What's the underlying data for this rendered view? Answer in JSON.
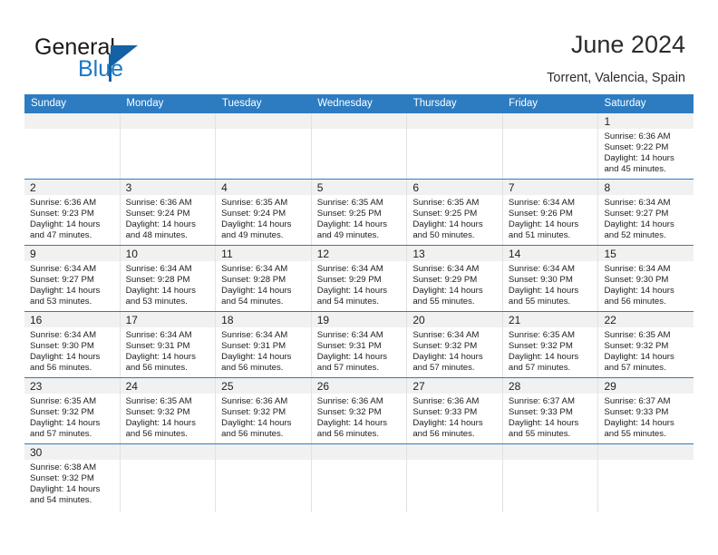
{
  "brand": {
    "name_top": "General",
    "name_bottom": "Blue",
    "accent_dark": "#1461a5",
    "accent_light": "#1b77c4"
  },
  "header": {
    "title": "June 2024",
    "subtitle": "Torrent, Valencia, Spain"
  },
  "calendar": {
    "header_bg": "#2d7cc1",
    "row_border": "#2d7cc1",
    "daynum_band_bg": "#f1f1f1",
    "weekday_headers": [
      "Sunday",
      "Monday",
      "Tuesday",
      "Wednesday",
      "Thursday",
      "Friday",
      "Saturday"
    ],
    "weeks": [
      [
        {
          "day": ""
        },
        {
          "day": ""
        },
        {
          "day": ""
        },
        {
          "day": ""
        },
        {
          "day": ""
        },
        {
          "day": ""
        },
        {
          "day": "1",
          "sunrise": "Sunrise: 6:36 AM",
          "sunset": "Sunset: 9:22 PM",
          "daylight_line1": "Daylight: 14 hours",
          "daylight_line2": "and 45 minutes."
        }
      ],
      [
        {
          "day": "2",
          "sunrise": "Sunrise: 6:36 AM",
          "sunset": "Sunset: 9:23 PM",
          "daylight_line1": "Daylight: 14 hours",
          "daylight_line2": "and 47 minutes."
        },
        {
          "day": "3",
          "sunrise": "Sunrise: 6:36 AM",
          "sunset": "Sunset: 9:24 PM",
          "daylight_line1": "Daylight: 14 hours",
          "daylight_line2": "and 48 minutes."
        },
        {
          "day": "4",
          "sunrise": "Sunrise: 6:35 AM",
          "sunset": "Sunset: 9:24 PM",
          "daylight_line1": "Daylight: 14 hours",
          "daylight_line2": "and 49 minutes."
        },
        {
          "day": "5",
          "sunrise": "Sunrise: 6:35 AM",
          "sunset": "Sunset: 9:25 PM",
          "daylight_line1": "Daylight: 14 hours",
          "daylight_line2": "and 49 minutes."
        },
        {
          "day": "6",
          "sunrise": "Sunrise: 6:35 AM",
          "sunset": "Sunset: 9:25 PM",
          "daylight_line1": "Daylight: 14 hours",
          "daylight_line2": "and 50 minutes."
        },
        {
          "day": "7",
          "sunrise": "Sunrise: 6:34 AM",
          "sunset": "Sunset: 9:26 PM",
          "daylight_line1": "Daylight: 14 hours",
          "daylight_line2": "and 51 minutes."
        },
        {
          "day": "8",
          "sunrise": "Sunrise: 6:34 AM",
          "sunset": "Sunset: 9:27 PM",
          "daylight_line1": "Daylight: 14 hours",
          "daylight_line2": "and 52 minutes."
        }
      ],
      [
        {
          "day": "9",
          "sunrise": "Sunrise: 6:34 AM",
          "sunset": "Sunset: 9:27 PM",
          "daylight_line1": "Daylight: 14 hours",
          "daylight_line2": "and 53 minutes."
        },
        {
          "day": "10",
          "sunrise": "Sunrise: 6:34 AM",
          "sunset": "Sunset: 9:28 PM",
          "daylight_line1": "Daylight: 14 hours",
          "daylight_line2": "and 53 minutes."
        },
        {
          "day": "11",
          "sunrise": "Sunrise: 6:34 AM",
          "sunset": "Sunset: 9:28 PM",
          "daylight_line1": "Daylight: 14 hours",
          "daylight_line2": "and 54 minutes."
        },
        {
          "day": "12",
          "sunrise": "Sunrise: 6:34 AM",
          "sunset": "Sunset: 9:29 PM",
          "daylight_line1": "Daylight: 14 hours",
          "daylight_line2": "and 54 minutes."
        },
        {
          "day": "13",
          "sunrise": "Sunrise: 6:34 AM",
          "sunset": "Sunset: 9:29 PM",
          "daylight_line1": "Daylight: 14 hours",
          "daylight_line2": "and 55 minutes."
        },
        {
          "day": "14",
          "sunrise": "Sunrise: 6:34 AM",
          "sunset": "Sunset: 9:30 PM",
          "daylight_line1": "Daylight: 14 hours",
          "daylight_line2": "and 55 minutes."
        },
        {
          "day": "15",
          "sunrise": "Sunrise: 6:34 AM",
          "sunset": "Sunset: 9:30 PM",
          "daylight_line1": "Daylight: 14 hours",
          "daylight_line2": "and 56 minutes."
        }
      ],
      [
        {
          "day": "16",
          "sunrise": "Sunrise: 6:34 AM",
          "sunset": "Sunset: 9:30 PM",
          "daylight_line1": "Daylight: 14 hours",
          "daylight_line2": "and 56 minutes."
        },
        {
          "day": "17",
          "sunrise": "Sunrise: 6:34 AM",
          "sunset": "Sunset: 9:31 PM",
          "daylight_line1": "Daylight: 14 hours",
          "daylight_line2": "and 56 minutes."
        },
        {
          "day": "18",
          "sunrise": "Sunrise: 6:34 AM",
          "sunset": "Sunset: 9:31 PM",
          "daylight_line1": "Daylight: 14 hours",
          "daylight_line2": "and 56 minutes."
        },
        {
          "day": "19",
          "sunrise": "Sunrise: 6:34 AM",
          "sunset": "Sunset: 9:31 PM",
          "daylight_line1": "Daylight: 14 hours",
          "daylight_line2": "and 57 minutes."
        },
        {
          "day": "20",
          "sunrise": "Sunrise: 6:34 AM",
          "sunset": "Sunset: 9:32 PM",
          "daylight_line1": "Daylight: 14 hours",
          "daylight_line2": "and 57 minutes."
        },
        {
          "day": "21",
          "sunrise": "Sunrise: 6:35 AM",
          "sunset": "Sunset: 9:32 PM",
          "daylight_line1": "Daylight: 14 hours",
          "daylight_line2": "and 57 minutes."
        },
        {
          "day": "22",
          "sunrise": "Sunrise: 6:35 AM",
          "sunset": "Sunset: 9:32 PM",
          "daylight_line1": "Daylight: 14 hours",
          "daylight_line2": "and 57 minutes."
        }
      ],
      [
        {
          "day": "23",
          "sunrise": "Sunrise: 6:35 AM",
          "sunset": "Sunset: 9:32 PM",
          "daylight_line1": "Daylight: 14 hours",
          "daylight_line2": "and 57 minutes."
        },
        {
          "day": "24",
          "sunrise": "Sunrise: 6:35 AM",
          "sunset": "Sunset: 9:32 PM",
          "daylight_line1": "Daylight: 14 hours",
          "daylight_line2": "and 56 minutes."
        },
        {
          "day": "25",
          "sunrise": "Sunrise: 6:36 AM",
          "sunset": "Sunset: 9:32 PM",
          "daylight_line1": "Daylight: 14 hours",
          "daylight_line2": "and 56 minutes."
        },
        {
          "day": "26",
          "sunrise": "Sunrise: 6:36 AM",
          "sunset": "Sunset: 9:32 PM",
          "daylight_line1": "Daylight: 14 hours",
          "daylight_line2": "and 56 minutes."
        },
        {
          "day": "27",
          "sunrise": "Sunrise: 6:36 AM",
          "sunset": "Sunset: 9:33 PM",
          "daylight_line1": "Daylight: 14 hours",
          "daylight_line2": "and 56 minutes."
        },
        {
          "day": "28",
          "sunrise": "Sunrise: 6:37 AM",
          "sunset": "Sunset: 9:33 PM",
          "daylight_line1": "Daylight: 14 hours",
          "daylight_line2": "and 55 minutes."
        },
        {
          "day": "29",
          "sunrise": "Sunrise: 6:37 AM",
          "sunset": "Sunset: 9:33 PM",
          "daylight_line1": "Daylight: 14 hours",
          "daylight_line2": "and 55 minutes."
        }
      ],
      [
        {
          "day": "30",
          "sunrise": "Sunrise: 6:38 AM",
          "sunset": "Sunset: 9:32 PM",
          "daylight_line1": "Daylight: 14 hours",
          "daylight_line2": "and 54 minutes."
        },
        {
          "day": ""
        },
        {
          "day": ""
        },
        {
          "day": ""
        },
        {
          "day": ""
        },
        {
          "day": ""
        },
        {
          "day": ""
        }
      ]
    ]
  }
}
